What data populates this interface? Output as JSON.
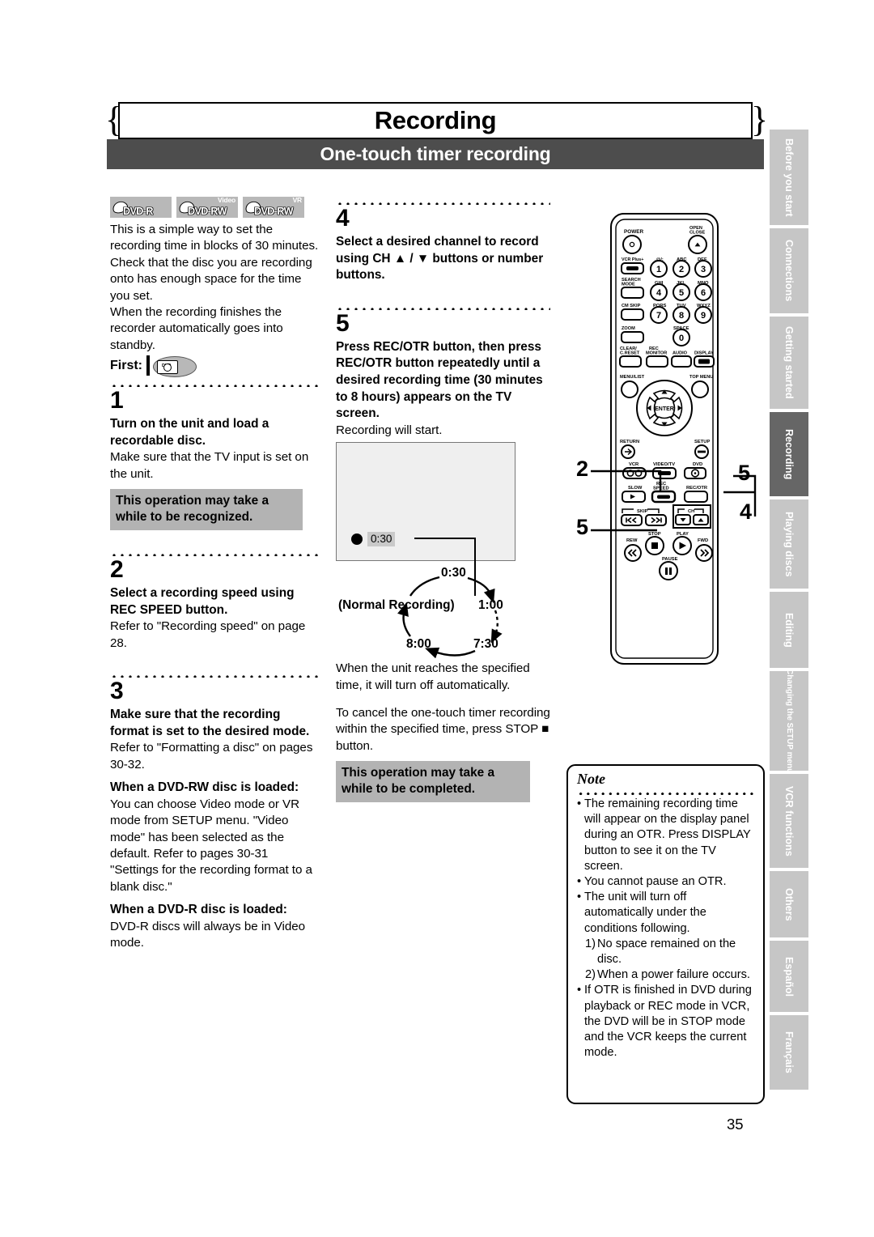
{
  "banner": {
    "chapter_title": "Recording",
    "section_title": "One-touch timer recording"
  },
  "page": {
    "number": "35"
  },
  "disc_logos": [
    {
      "top": "",
      "main": "DVD-R",
      "name": "dvd-r-logo"
    },
    {
      "top": "Video",
      "main": "DVD-RW",
      "name": "dvd-rw-video-logo"
    },
    {
      "top": "VR",
      "main": "DVD-RW",
      "name": "dvd-rw-vr-logo"
    }
  ],
  "left_column": {
    "intro": "This is a simple way to set the recording time in blocks of 30 minutes. Check that the disc you are recording onto has enough space for the time you set.",
    "intro2": "When the recording finishes the recorder automatically goes into standby.",
    "first_label": "First:",
    "step1": {
      "number": "1",
      "heading": "Turn on the unit and load a recordable disc.",
      "body": "Make sure that the TV input is set on the unit.",
      "callout": "This operation may take a while to be recognized."
    },
    "step2": {
      "number": "2",
      "heading": "Select a recording speed using REC SPEED button.",
      "body": "Refer to \"Recording speed\" on page 28."
    },
    "step3": {
      "number": "3",
      "heading": "Make sure that the recording format is set to the desired mode.",
      "body": "Refer to \"Formatting a disc\" on pages 30-32.",
      "sub1_heading": "When a DVD-RW disc is loaded:",
      "sub1_body": "You can choose Video mode or VR mode from SETUP menu. \"Video mode\" has been selected as the default. Refer to pages 30-31 \"Settings for the recording format to a blank disc.\"",
      "sub2_heading": "When a DVD-R disc is loaded:",
      "sub2_body": "DVD-R discs will always be in Video mode."
    }
  },
  "mid_column": {
    "step4": {
      "number": "4",
      "heading": "Select a desired channel to record using CH ▲ / ▼ buttons or number buttons."
    },
    "step5": {
      "number": "5",
      "heading": "Press REC/OTR button, then press REC/OTR button repeatedly until a desired recording time (30 minutes to 8 hours) appears on the TV screen.",
      "body": "Recording will start."
    },
    "tv_figure": {
      "rec_time": "0:30"
    },
    "cycle_diagram": {
      "top": "0:30",
      "right": "1:00",
      "bottom_right": "7:30",
      "bottom_left": "8:00",
      "left": "(Normal Recording)"
    },
    "after1": "When the unit reaches the specified time, it will turn off automatically.",
    "after2": "To cancel the one-touch timer recording within the specified time, press STOP ■ button.",
    "callout": "This operation may take a while to be completed."
  },
  "note": {
    "title": "Note",
    "items": [
      {
        "text": "The remaining recording time will appear on the display panel during an OTR. Press DISPLAY button to see it on the TV screen."
      },
      {
        "text": "You cannot pause an OTR."
      },
      {
        "text": "The unit will turn off automatically under the conditions following.",
        "subs": [
          {
            "num": "1)",
            "text": "No space remained on the disc."
          },
          {
            "num": "2)",
            "text": "When a power failure occurs."
          }
        ]
      },
      {
        "text": "If OTR is finished in DVD during playback or REC mode in VCR, the DVD will be in STOP mode and the VCR keeps the current mode."
      }
    ]
  },
  "sidebar": {
    "tabs": [
      {
        "label": "Before you start",
        "active": false
      },
      {
        "label": "Connections",
        "active": false
      },
      {
        "label": "Getting started",
        "active": false
      },
      {
        "label": "Recording",
        "active": true
      },
      {
        "label": "Playing discs",
        "active": false
      },
      {
        "label": "Editing",
        "active": false
      },
      {
        "label": "Changing the SETUP menu",
        "active": false
      },
      {
        "label": "VCR functions",
        "active": false
      },
      {
        "label": "Others",
        "active": false
      },
      {
        "label": "Español",
        "active": false
      },
      {
        "label": "Français",
        "active": false
      }
    ]
  },
  "remote": {
    "labels": {
      "power": "POWER",
      "open_close": "OPEN/CLOSE",
      "vcr_plus": "VCR Plus+",
      "search_mode": "SEARCH MODE",
      "cm_skip": "CM SKIP",
      "zoom": "ZOOM",
      "clear_creset": "CLEAR/C.RESET",
      "rec_monitor": "REC MONITOR",
      "audio": "AUDIO",
      "display": "DISPLAY",
      "menu_list": "MENU/LIST",
      "top_menu": "TOP MENU",
      "enter": "ENTER",
      "return": "RETURN",
      "setup": "SETUP",
      "vcr": "VCR",
      "video_tv": "VIDEO/TV",
      "dvd": "DVD",
      "slow": "SLOW",
      "rec_speed": "REC SPEED",
      "rec_otr": "REC/OTR",
      "skip": "SKIP",
      "ch": "CH",
      "stop": "STOP",
      "play": "PLAY",
      "rew": "REW",
      "fwd": "FWD",
      "pause": "PAUSE"
    },
    "keypad": [
      {
        "sub": ".@/:",
        "digit": "1"
      },
      {
        "sub": "ABC",
        "digit": "2"
      },
      {
        "sub": "DEF",
        "digit": "3"
      },
      {
        "sub": "GHI",
        "digit": "4"
      },
      {
        "sub": "JKL",
        "digit": "5"
      },
      {
        "sub": "MNO",
        "digit": "6"
      },
      {
        "sub": "PQRS",
        "digit": "7"
      },
      {
        "sub": "TUV",
        "digit": "8"
      },
      {
        "sub": "WXYZ",
        "digit": "9"
      },
      {
        "sub": "SPACE",
        "digit": "0"
      }
    ],
    "callouts": [
      {
        "id": "co-2",
        "label": "2"
      },
      {
        "id": "co-5a",
        "label": "5"
      },
      {
        "id": "co-5b",
        "label": "5"
      },
      {
        "id": "co-4",
        "label": "4"
      }
    ]
  }
}
